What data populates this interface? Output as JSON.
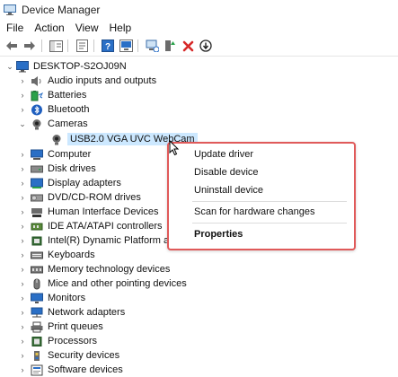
{
  "window": {
    "title": "Device Manager",
    "app_icon": "device-manager-icon"
  },
  "menu": [
    "File",
    "Action",
    "View",
    "Help"
  ],
  "toolbar": {
    "buttons": [
      "back-arrow-icon",
      "forward-arrow-icon",
      "show-hide-console-tree-icon",
      "properties-icon",
      "help-icon",
      "scan-hardware-icon",
      "update-driver-icon",
      "uninstall-icon",
      "disable-device-icon"
    ]
  },
  "tree": {
    "root": "DESKTOP-S2OJ09N",
    "items": [
      {
        "label": "Audio inputs and outputs",
        "icon": "speaker-icon",
        "expanded": false
      },
      {
        "label": "Batteries",
        "icon": "battery-icon",
        "expanded": false
      },
      {
        "label": "Bluetooth",
        "icon": "bluetooth-icon",
        "expanded": false
      },
      {
        "label": "Cameras",
        "icon": "camera-icon",
        "expanded": true
      },
      {
        "label": "USB2.0 VGA UVC WebCam",
        "icon": "webcam-icon",
        "child": true,
        "selected": true
      },
      {
        "label": "Computer",
        "icon": "computer-icon",
        "expanded": false
      },
      {
        "label": "Disk drives",
        "icon": "disk-icon",
        "expanded": false
      },
      {
        "label": "Display adapters",
        "icon": "display-adapter-icon",
        "expanded": false
      },
      {
        "label": "DVD/CD-ROM drives",
        "icon": "dvd-icon",
        "expanded": false
      },
      {
        "label": "Human Interface Devices",
        "icon": "hid-icon",
        "expanded": false
      },
      {
        "label": "IDE ATA/ATAPI controllers",
        "icon": "ide-controller-icon",
        "expanded": false
      },
      {
        "label": "Intel(R) Dynamic Platform a",
        "icon": "chip-icon",
        "expanded": false
      },
      {
        "label": "Keyboards",
        "icon": "keyboard-icon",
        "expanded": false
      },
      {
        "label": "Memory technology devices",
        "icon": "memory-icon",
        "expanded": false
      },
      {
        "label": "Mice and other pointing devices",
        "icon": "mouse-icon",
        "expanded": false
      },
      {
        "label": "Monitors",
        "icon": "monitor-icon",
        "expanded": false
      },
      {
        "label": "Network adapters",
        "icon": "network-icon",
        "expanded": false
      },
      {
        "label": "Print queues",
        "icon": "printer-icon",
        "expanded": false
      },
      {
        "label": "Processors",
        "icon": "processor-icon",
        "expanded": false
      },
      {
        "label": "Security devices",
        "icon": "security-icon",
        "expanded": false
      },
      {
        "label": "Software devices",
        "icon": "software-icon",
        "expanded": false
      }
    ]
  },
  "context_menu": {
    "items": [
      "Update driver",
      "Disable device",
      "Uninstall device",
      "Scan for hardware changes",
      "Properties"
    ],
    "highlight_color": "#e05a5a"
  },
  "colors": {
    "selection": "#cce8ff",
    "accent_blue": "#2a6fc6",
    "red": "#d62828"
  }
}
